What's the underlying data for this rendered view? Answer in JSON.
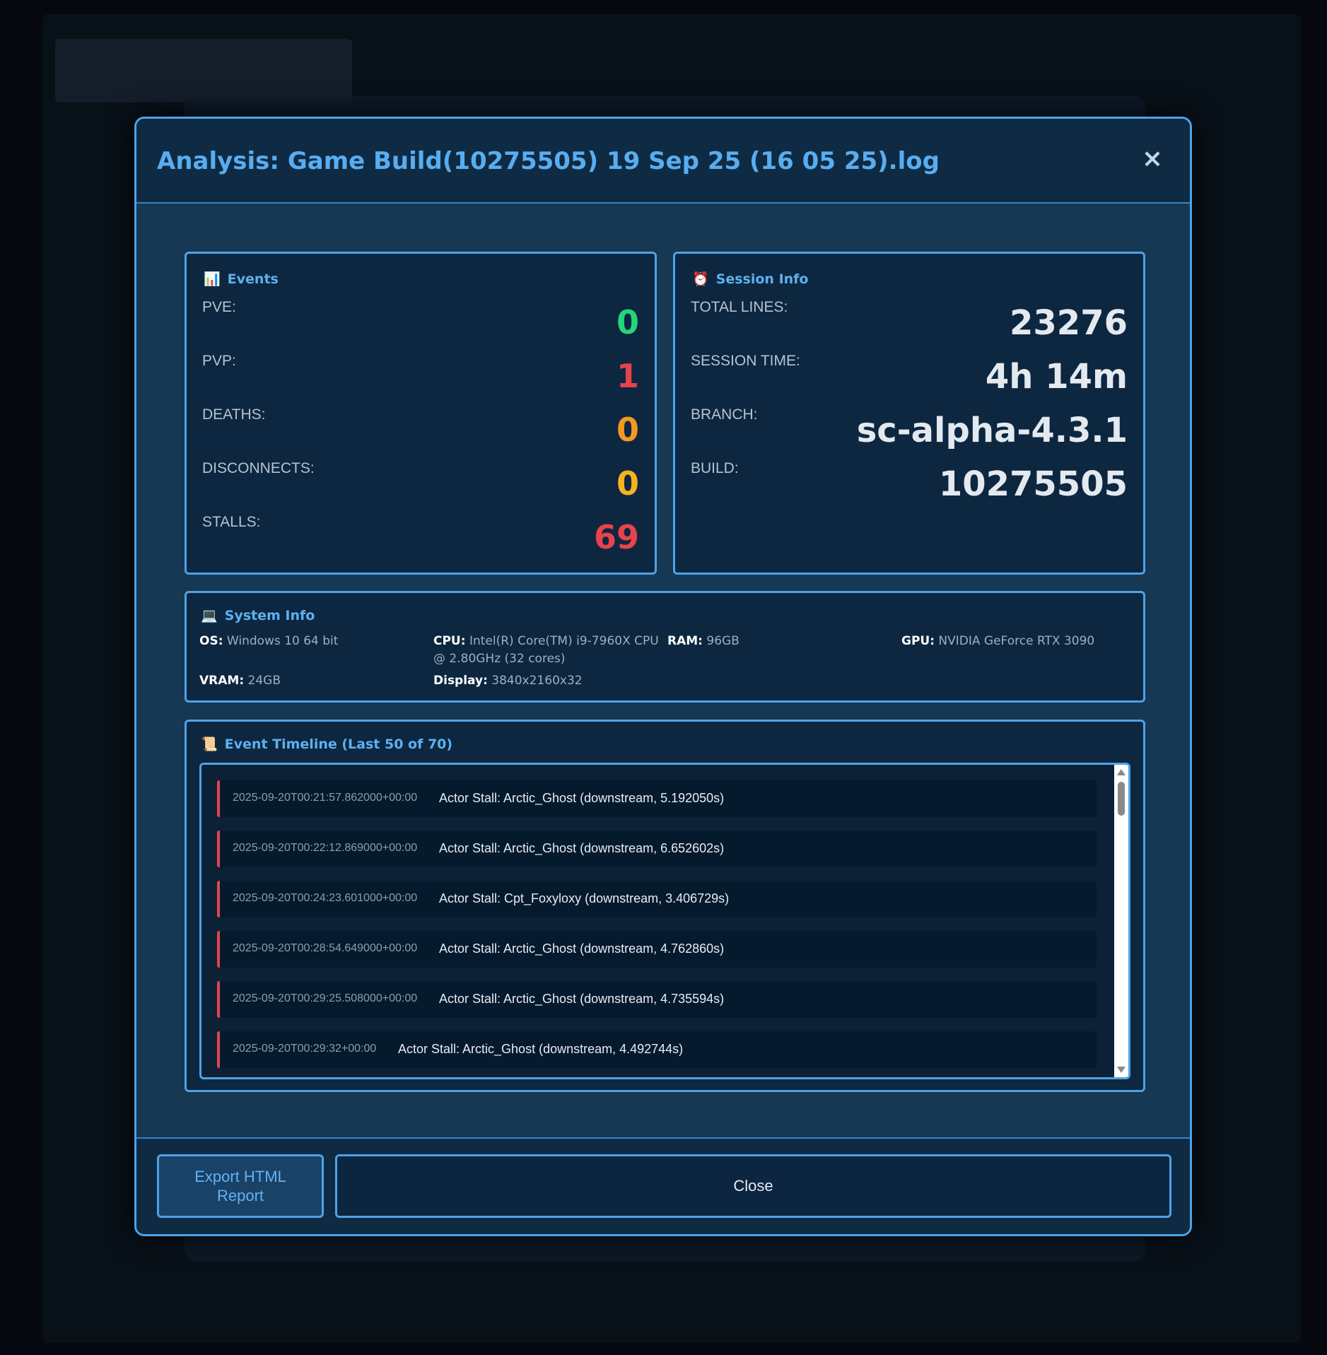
{
  "modal": {
    "title": "Analysis: Game Build(10275505) 19 Sep 25 (16 05 25).log",
    "close_icon": "×"
  },
  "events": {
    "icon": "📊",
    "title": "Events",
    "rows": [
      {
        "label": "PVE:",
        "value": "0",
        "color": "#22d67a"
      },
      {
        "label": "PVP:",
        "value": "1",
        "color": "#e8434b"
      },
      {
        "label": "DEATHS:",
        "value": "0",
        "color": "#f39a1e"
      },
      {
        "label": "DISCONNECTS:",
        "value": "0",
        "color": "#f5b320"
      },
      {
        "label": "STALLS:",
        "value": "69",
        "color": "#e8434b"
      }
    ]
  },
  "session": {
    "icon": "⏰",
    "title": "Session Info",
    "rows": [
      {
        "label": "TOTAL LINES:",
        "value": "23276"
      },
      {
        "label": "SESSION TIME:",
        "value": "4h 14m"
      },
      {
        "label": "BRANCH:",
        "value": "sc-alpha-4.3.1"
      },
      {
        "label": "BUILD:",
        "value": "10275505"
      }
    ]
  },
  "system": {
    "icon": "💻",
    "title": "System Info",
    "os_label": "OS:",
    "os": "Windows 10 64 bit",
    "cpu_label": "CPU:",
    "cpu": "Intel(R) Core(TM) i9-7960X CPU @ 2.80GHz (32 cores)",
    "ram_label": "RAM:",
    "ram": "96GB",
    "gpu_label": "GPU:",
    "gpu": "NVIDIA GeForce RTX 3090",
    "vram_label": "VRAM:",
    "vram": "24GB",
    "display_label": "Display:",
    "display": "3840x2160x32"
  },
  "timeline": {
    "icon": "📜",
    "title": "Event Timeline (Last 50 of 70)",
    "items": [
      {
        "time": "2025-09-20T00:21:57.862000+00:00",
        "message": "Actor Stall: Arctic_Ghost (downstream, 5.192050s)"
      },
      {
        "time": "2025-09-20T00:22:12.869000+00:00",
        "message": "Actor Stall: Arctic_Ghost (downstream, 6.652602s)"
      },
      {
        "time": "2025-09-20T00:24:23.601000+00:00",
        "message": "Actor Stall: Cpt_Foxyloxy (downstream, 3.406729s)"
      },
      {
        "time": "2025-09-20T00:28:54.649000+00:00",
        "message": "Actor Stall: Arctic_Ghost (downstream, 4.762860s)"
      },
      {
        "time": "2025-09-20T00:29:25.508000+00:00",
        "message": "Actor Stall: Arctic_Ghost (downstream, 4.735594s)"
      },
      {
        "time": "2025-09-20T00:29:32+00:00",
        "message": "Actor Stall: Arctic_Ghost (downstream, 4.492744s)"
      }
    ],
    "accent_color": "#e0454c"
  },
  "footer": {
    "export_label": "Export HTML Report",
    "close_label": "Close"
  },
  "colors": {
    "accent": "#4da3e8",
    "title": "#58adf0"
  }
}
